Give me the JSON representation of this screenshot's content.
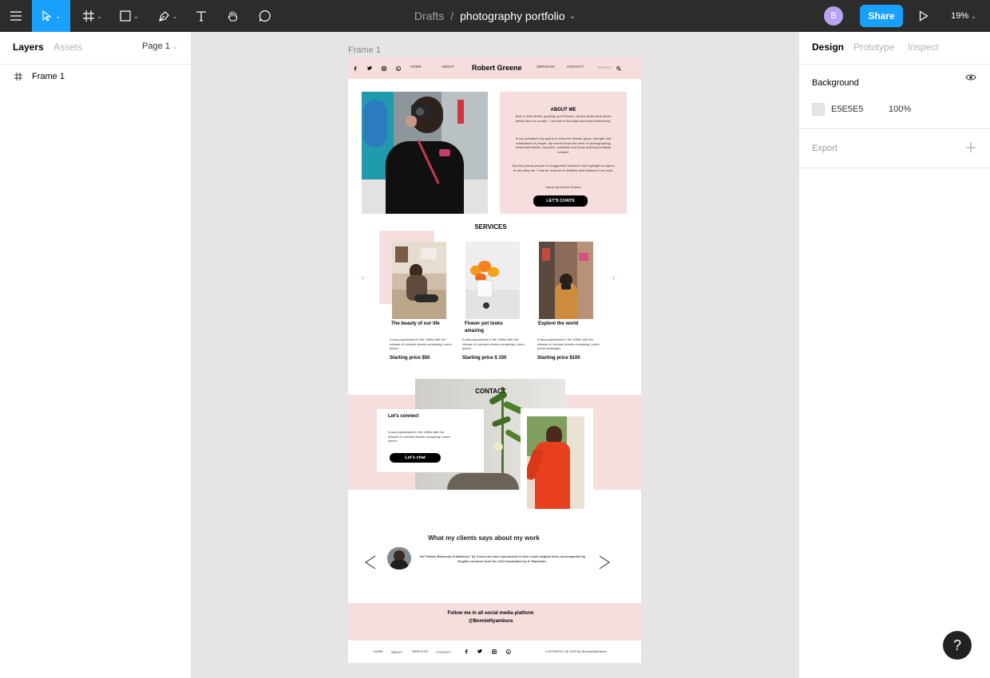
{
  "topbar": {
    "breadcrumb_drafts": "Drafts",
    "breadcrumb_sep": "/",
    "file_name": "photography portfolio",
    "avatar_initial": "B",
    "share_label": "Share",
    "zoom": "19%"
  },
  "left_panel": {
    "tab_layers": "Layers",
    "tab_assets": "Assets",
    "page_label": "Page 1",
    "layers": [
      {
        "name": "Frame 1"
      }
    ]
  },
  "right_panel": {
    "tab_design": "Design",
    "tab_prototype": "Prototype",
    "tab_inspect": "Inspect",
    "background_heading": "Background",
    "bg_hex": "E5E5E5",
    "bg_opacity": "100%",
    "export_heading": "Export",
    "accent_color": "#18a0fb"
  },
  "canvas": {
    "frame_label": "Frame 1",
    "site": {
      "nav": {
        "home": "HOME",
        "about": "ABOUT",
        "brand": "Robert Greene",
        "services": "SERVICES",
        "contact": "CONTACT",
        "search": "SEARCH"
      },
      "about": {
        "heading": "ABOUT ME",
        "p1": "Born in East Berlin, growing up in Russia, my first years were spent behind the iron curtain. I now live in Brooklyn and travel extensively.",
        "p2": "In my portraiture my goal is to show the beauty, grace, strength and enthusiasm of people. My recent focus has been on photographing environmentalists, explorers, scientists and those pushing humanity forward.",
        "p3": "My work places people in exaggerated situations that highlight an aspect of who they are. I look for a sense of defiance and fortitude in my work.",
        "credit": "*photo by Robert Greene",
        "cta": "LET'S CHATS"
      },
      "services": {
        "heading": "SERVICES",
        "items": [
          {
            "title": "The beauty of our life",
            "desc": "It was popularised in the 1960s with the release of Letraset sheets containing Lorem Ipsum",
            "price": "Starting price $50"
          },
          {
            "title": "Flower pot looks amazing",
            "desc": "It was popularised in the 1960s with the release of Letraset sheets containing Lorem Ipsum",
            "price": "Starting price $ 150"
          },
          {
            "title": "Explore the world",
            "desc": "It was popularised in the 1960s with the release of Letraset sheets containing Lorem Ipsum passages",
            "price": "Starting price $100"
          }
        ]
      },
      "contact": {
        "heading": "CONTACT",
        "card_title": "Let's connect",
        "card_text": "It was popularised in the 1960s with the release of Letraset sheets containing Lorem Ipsum",
        "cta": "Let's chat"
      },
      "testimonials": {
        "heading": "What my clients says about my work",
        "quote": "\"de Finibus Bonorum et Malorum\" by Cicero are also reproduced in their exact original form, accompanied by English versions from the 1914 translation by H. Rackham."
      },
      "follow": {
        "line1": "Follow me in all social media platform",
        "line2": "@BonnieNyambura"
      },
      "footer": {
        "home": "HOME",
        "about": "ABOUT",
        "services": "SERVICES",
        "contact": "CONTACT",
        "copyright": "COPYRIGHT @ 2020 By BonnieNyambura"
      }
    }
  }
}
